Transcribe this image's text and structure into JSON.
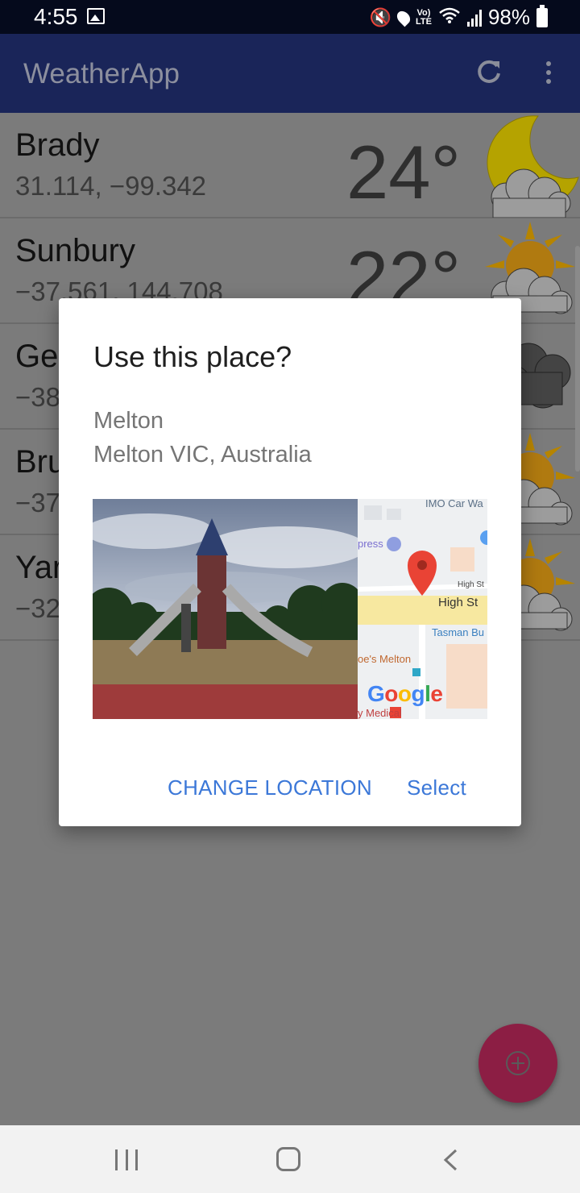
{
  "status_bar": {
    "time": "4:55",
    "volte_line1": "Vo)",
    "volte_line2": "LTE",
    "battery": "98%"
  },
  "app_bar": {
    "title": "WeatherApp",
    "refresh_icon": "refresh-icon",
    "more_icon": "more-vert-icon"
  },
  "locations": [
    {
      "name": "Brady",
      "coords": "31.114, −99.342",
      "temp": "24°",
      "icon": "moon-cloud-icon"
    },
    {
      "name": "Sunbury",
      "coords": "−37.561, 144.708",
      "temp": "22°",
      "icon": "sun-cloud-icon"
    },
    {
      "name": "Ge",
      "coords": "−38",
      "temp": "",
      "icon": "cloud-icon"
    },
    {
      "name": "Bru",
      "coords": "−37",
      "temp": "",
      "icon": "sun-cloud-icon"
    },
    {
      "name": "Yar",
      "coords": "−32",
      "temp": "",
      "icon": "sun-cloud-icon"
    }
  ],
  "dialog": {
    "title": "Use this place?",
    "place_name": "Melton",
    "place_address": "Melton VIC, Australia",
    "map_labels": {
      "car_wash": "IMO Car Wa",
      "press": "press",
      "high_st_small": "High St",
      "high_st": "High St",
      "tasman": "Tasman Bu",
      "joes": "oe's Melton",
      "medical": "y Medical"
    },
    "google_logo": "Google",
    "change_location": "CHANGE LOCATION",
    "select": "Select"
  },
  "fab": {
    "icon": "add-location-icon"
  },
  "colors": {
    "app_bar": "#1a2559",
    "accent_button": "#3c78d8",
    "fab": "#8c1e44",
    "scrim_bg": "#7b7b7b"
  }
}
